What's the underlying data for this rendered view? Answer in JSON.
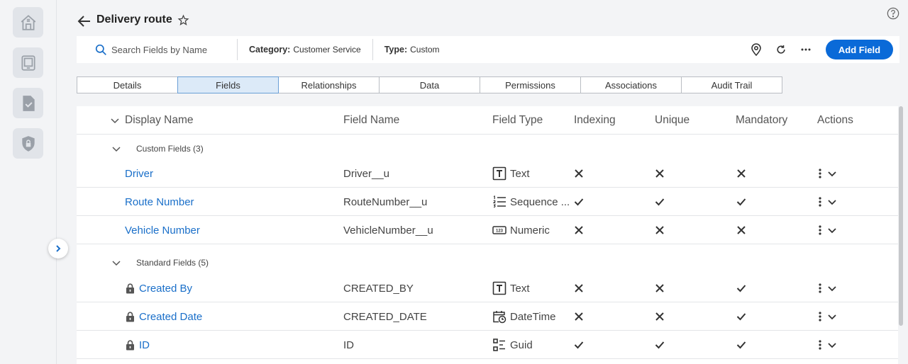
{
  "header": {
    "title": "Delivery route"
  },
  "toolbar": {
    "search_placeholder": "Search Fields by Name",
    "category_label": "Category:",
    "category_value": "Customer Service",
    "type_label": "Type:",
    "type_value": "Custom",
    "add_field_label": "Add Field"
  },
  "tabs": [
    {
      "label": "Details"
    },
    {
      "label": "Fields"
    },
    {
      "label": "Relationships"
    },
    {
      "label": "Data"
    },
    {
      "label": "Permissions"
    },
    {
      "label": "Associations"
    },
    {
      "label": "Audit Trail"
    }
  ],
  "columns": {
    "display_name": "Display Name",
    "field_name": "Field Name",
    "field_type": "Field Type",
    "indexing": "Indexing",
    "unique": "Unique",
    "mandatory": "Mandatory",
    "actions": "Actions"
  },
  "groups": {
    "custom": "Custom Fields (3)",
    "standard": "Standard Fields (5)"
  },
  "rows": [
    {
      "display": "Driver",
      "field": "Driver__u",
      "type": "Text",
      "indexing": false,
      "unique": false,
      "mandatory": false
    },
    {
      "display": "Route Number",
      "field": "RouteNumber__u",
      "type": "Sequence ...",
      "indexing": true,
      "unique": true,
      "mandatory": true
    },
    {
      "display": "Vehicle Number",
      "field": "VehicleNumber__u",
      "type": "Numeric",
      "indexing": false,
      "unique": false,
      "mandatory": false
    },
    {
      "display": "Created By",
      "field": "CREATED_BY",
      "type": "Text",
      "indexing": false,
      "unique": false,
      "mandatory": true
    },
    {
      "display": "Created Date",
      "field": "CREATED_DATE",
      "type": "DateTime",
      "indexing": false,
      "unique": false,
      "mandatory": true
    },
    {
      "display": "ID",
      "field": "ID",
      "type": "Guid",
      "indexing": true,
      "unique": true,
      "mandatory": true
    }
  ],
  "colors": {
    "accent": "#0a6ad8",
    "link": "#1a6fc9",
    "active_tab_bg": "#dceaf8"
  }
}
